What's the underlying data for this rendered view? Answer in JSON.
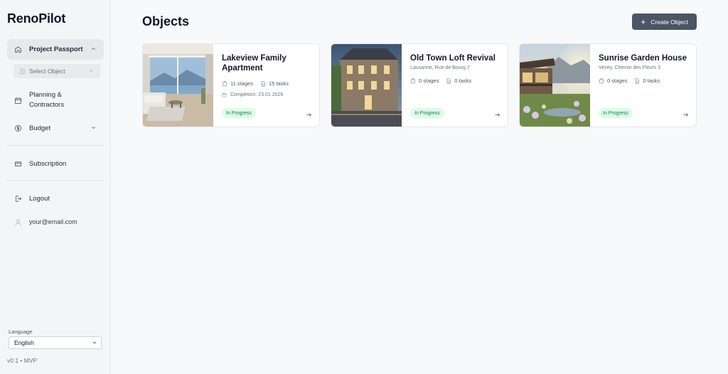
{
  "brand": "RenoPilot",
  "sidebar": {
    "items": [
      {
        "label": "Project Passport"
      },
      {
        "label": "Planning &\nContractors"
      },
      {
        "label": "Budget"
      },
      {
        "label": "Subscription"
      },
      {
        "label": "Logout"
      },
      {
        "label": "your@email.com"
      }
    ],
    "select_object": "Select Object",
    "language_label": "Language",
    "language_value": "English",
    "version": "v0.1 • MVP"
  },
  "main": {
    "title": "Objects",
    "create_button": "Create Object",
    "cards": [
      {
        "title": "Lakeview Family Apartment",
        "stages": "11 stages",
        "tasks": "15 tasks",
        "completion": "Completion: 23.01.2026",
        "status": "In Progress"
      },
      {
        "title": "Old Town Loft Revival",
        "address": "Lausanne, Rue de Bourg 7",
        "stages": "0 stages",
        "tasks": "0 tasks",
        "status": "In Progress"
      },
      {
        "title": "Sunrise Garden House",
        "address": "Vevey, Chemin des Fleurs 3",
        "stages": "0 stages",
        "tasks": "0 tasks",
        "status": "In Progress"
      }
    ]
  },
  "colors": {
    "accent_button": "#4b5563",
    "status_bg": "#dcfce7",
    "status_text": "#15803d",
    "arrow": "#1d4ed8"
  },
  "icons": [
    "home-icon",
    "building-icon",
    "calendar-icon",
    "dollar-icon",
    "credit-card-icon",
    "logout-icon",
    "user-icon",
    "clipboard-icon",
    "file-icon",
    "arrow-right-icon",
    "chevron-up-icon",
    "chevron-down-icon",
    "plus-icon"
  ]
}
